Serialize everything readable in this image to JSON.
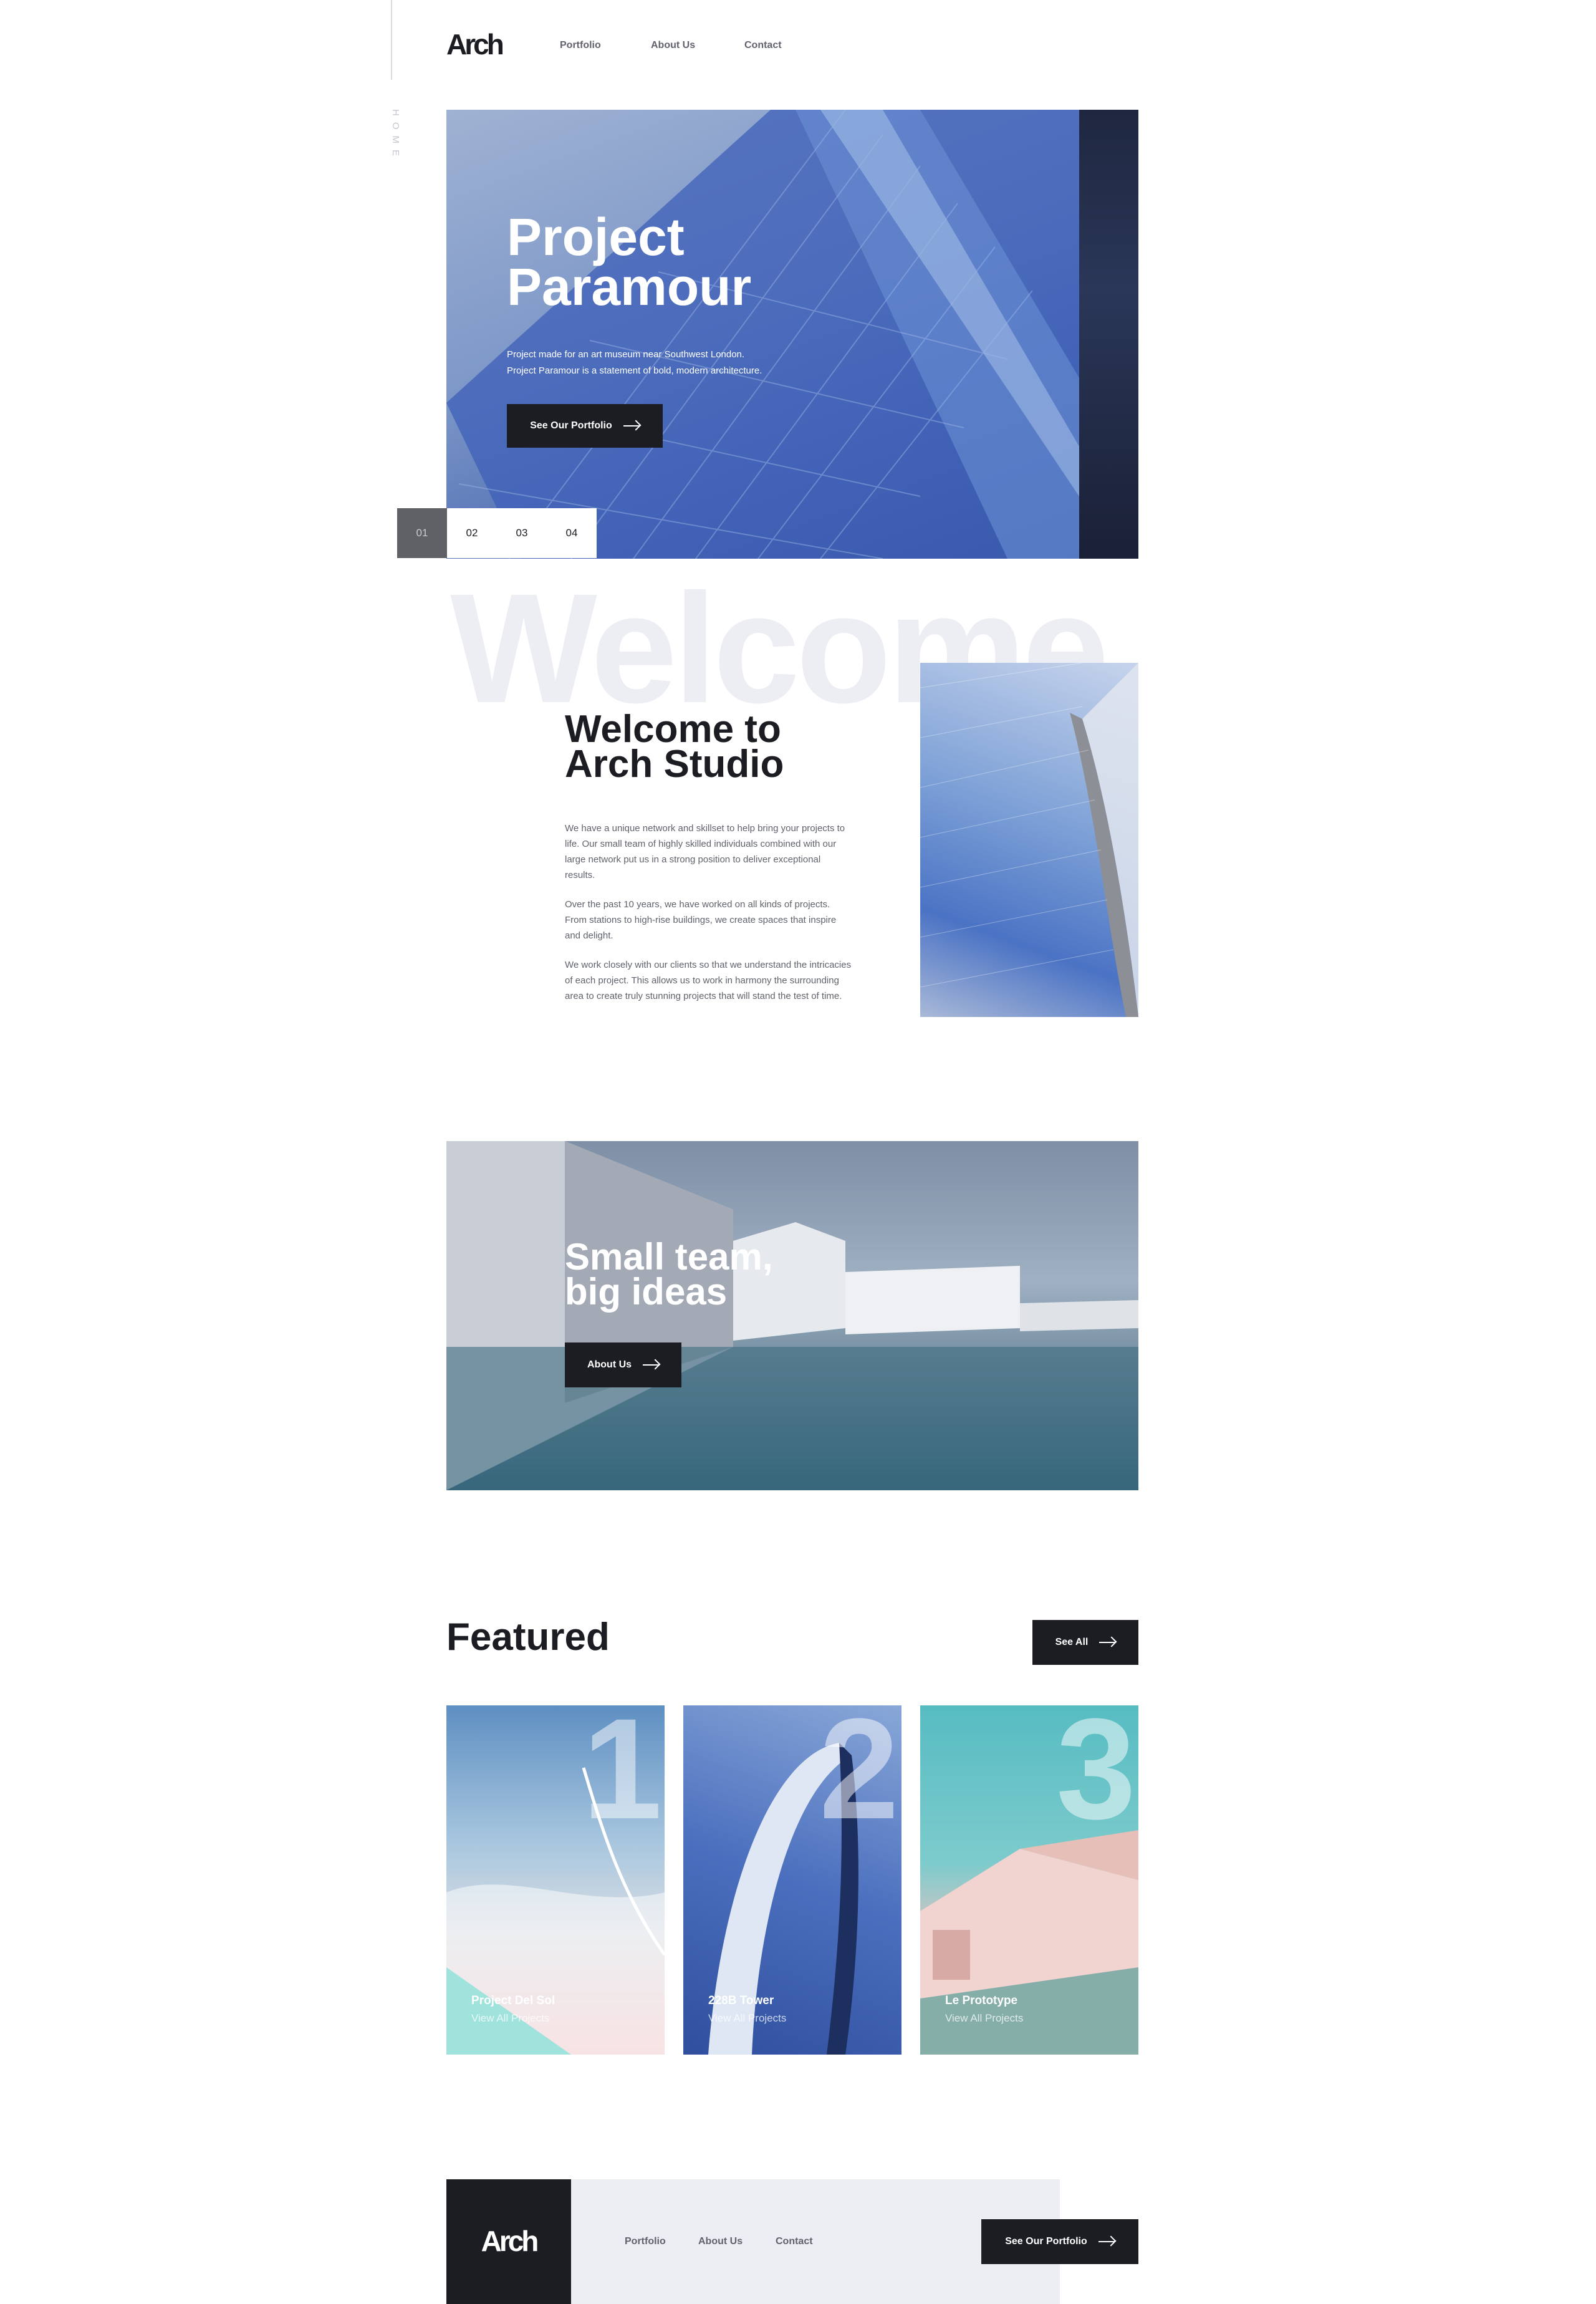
{
  "header": {
    "logo": "Arch",
    "nav": [
      "Portfolio",
      "About Us",
      "Contact"
    ],
    "side_label": "Home"
  },
  "hero": {
    "title_line1": "Project",
    "title_line2": "Paramour",
    "desc_line1": "Project made for an art museum near Southwest London.",
    "desc_line2": "Project Paramour is a statement of bold, modern architecture.",
    "button_label": "See Our Portfolio",
    "pager": [
      "01",
      "02",
      "03",
      "04"
    ],
    "active_slide": "01"
  },
  "welcome": {
    "background_word": "Welcome",
    "title_line1": "Welcome to",
    "title_line2": "Arch Studio",
    "paragraphs": [
      "We have a unique network and skillset to help bring your projects to life. Our small team of highly skilled individuals combined with our large network put us in a strong position to deliver exceptional results.",
      "Over the past 10 years, we have worked on all kinds of projects. From stations to high-rise buildings, we create spaces that inspire and delight.",
      "We work closely with our clients so that we understand the intricacies of each project. This allows us to work in harmony the surrounding area to create truly stunning projects that will stand the test of time."
    ]
  },
  "team": {
    "title_line1": "Small team,",
    "title_line2": "big ideas",
    "button_label": "About Us"
  },
  "featured": {
    "title": "Featured",
    "button_label": "See All",
    "cards": [
      {
        "number": "1",
        "name": "Project Del Sol",
        "link": "View All Projects"
      },
      {
        "number": "2",
        "name": "228B Tower",
        "link": "View All Projects"
      },
      {
        "number": "3",
        "name": "Le Prototype",
        "link": "View All Projects"
      }
    ]
  },
  "footer": {
    "logo": "Arch",
    "nav": [
      "Portfolio",
      "About Us",
      "Contact"
    ],
    "button_label": "See Our Portfolio"
  }
}
